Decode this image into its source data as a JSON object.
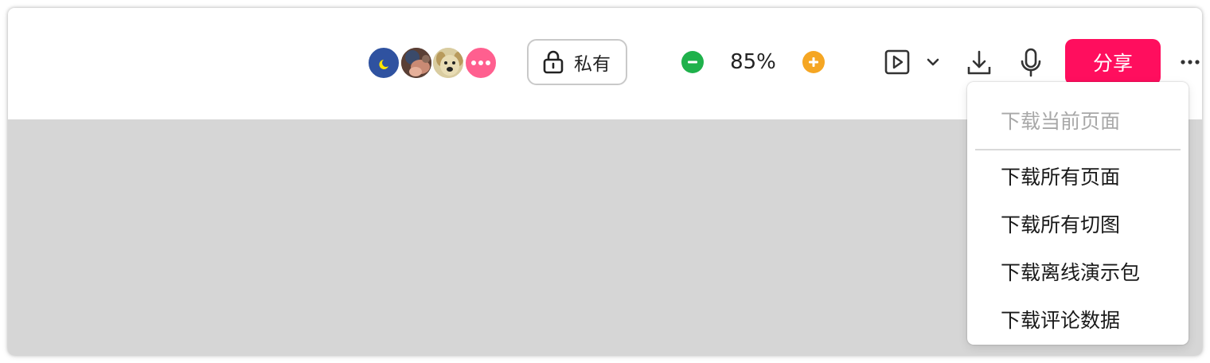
{
  "colors": {
    "share_button": "#ff0e5e",
    "zoom_out": "#1fb14b",
    "zoom_in": "#f5a623",
    "more_users_avatar": "#ff5f8f",
    "canvas_background": "#d6d6d6"
  },
  "collaborators": {
    "avatars": [
      {
        "name": "avatar-blue-moon",
        "icon": "moon-icon"
      },
      {
        "name": "avatar-photo",
        "icon": "photo-avatar"
      },
      {
        "name": "avatar-dog",
        "icon": "dog-avatar"
      }
    ],
    "more_icon": "more-users-icon"
  },
  "privacy": {
    "icon": "lock-icon",
    "label": "私有"
  },
  "zoom": {
    "out_icon": "minus-icon",
    "value": "85%",
    "in_icon": "plus-icon"
  },
  "toolbar": {
    "present_icon": "play-icon",
    "present_menu_icon": "chevron-down-icon",
    "download_icon": "download-icon",
    "voice_icon": "microphone-icon",
    "share_label": "分享",
    "more_icon": "more-icon"
  },
  "download_menu": {
    "items": [
      {
        "label": "下载当前页面",
        "disabled": true
      },
      {
        "label": "下载所有页面",
        "disabled": false
      },
      {
        "label": "下载所有切图",
        "disabled": false
      },
      {
        "label": "下载离线演示包",
        "disabled": false
      },
      {
        "label": "下载评论数据",
        "disabled": false
      }
    ]
  }
}
